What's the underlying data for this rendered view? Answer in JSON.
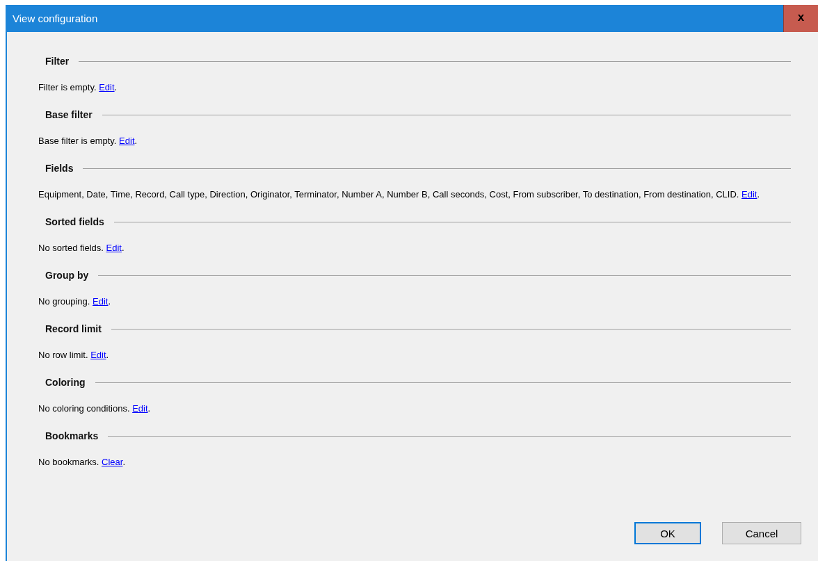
{
  "window": {
    "title": "View configuration",
    "close_button": "x"
  },
  "sections": [
    {
      "heading": "Filter",
      "text": "Filter is empty.",
      "link": "Edit",
      "suffix": "."
    },
    {
      "heading": "Base filter",
      "text": "Base filter is empty.",
      "link": "Edit",
      "suffix": "."
    },
    {
      "heading": "Fields",
      "text": "Equipment, Date, Time, Record, Call type, Direction, Originator, Terminator, Number A, Number B, Call seconds, Cost, From subscriber, To destination, From destination, CLID.",
      "link": "Edit",
      "suffix": "."
    },
    {
      "heading": "Sorted fields",
      "text": "No sorted fields.",
      "link": "Edit",
      "suffix": "."
    },
    {
      "heading": "Group by",
      "text": "No grouping.",
      "link": "Edit",
      "suffix": "."
    },
    {
      "heading": "Record limit",
      "text": "No row limit.",
      "link": "Edit",
      "suffix": "."
    },
    {
      "heading": "Coloring",
      "text": "No coloring conditions.",
      "link": "Edit",
      "suffix": "."
    },
    {
      "heading": "Bookmarks",
      "text": "No bookmarks.",
      "link": "Clear",
      "suffix": "."
    }
  ],
  "buttons": [
    {
      "label": "OK",
      "default": true
    },
    {
      "label": "Cancel",
      "default": false
    }
  ]
}
